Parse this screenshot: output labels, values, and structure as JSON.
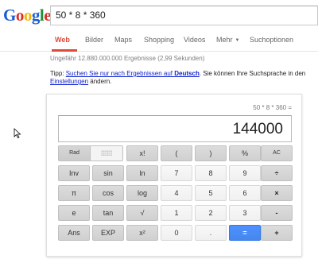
{
  "header": {
    "logo": [
      "G",
      "o",
      "o",
      "g",
      "l",
      "e"
    ],
    "logo_colors": [
      "#1a5fd1",
      "#d93025",
      "#f4b400",
      "#1a5fd1",
      "#1e8e3e",
      "#d93025"
    ],
    "search_value": "50 * 8 * 360"
  },
  "nav": {
    "tabs": [
      "Web",
      "Bilder",
      "Maps",
      "Shopping",
      "Videos",
      "Mehr",
      "Suchoptionen"
    ],
    "active": "Web",
    "accent": "#dd4b39"
  },
  "results": {
    "stats": "Ungefähr 12.880.000.000 Ergebnisse (2,99 Sekunden)",
    "tip_prefix": "Tipp: ",
    "tip_link1": "Suchen Sie nur nach Ergebnissen auf ",
    "tip_link1_bold": "Deutsch",
    "tip_mid": ". Sie können Ihre Suchsprache in den ",
    "tip_link2": "Einstellungen",
    "tip_suffix": " ändern."
  },
  "calculator": {
    "expression": "50 * 8 * 360 =",
    "display": "144000",
    "rad_label": "Rad",
    "buttons": [
      [
        "x!",
        "(",
        ")",
        "%",
        "AC"
      ],
      [
        "Inv",
        "sin",
        "ln",
        "7",
        "8",
        "9",
        "÷"
      ],
      [
        "π",
        "cos",
        "log",
        "4",
        "5",
        "6",
        "×"
      ],
      [
        "e",
        "tan",
        "√",
        "1",
        "2",
        "3",
        "-"
      ],
      [
        "Ans",
        "EXP",
        "x²",
        "0",
        ".",
        "=",
        "+"
      ]
    ]
  }
}
